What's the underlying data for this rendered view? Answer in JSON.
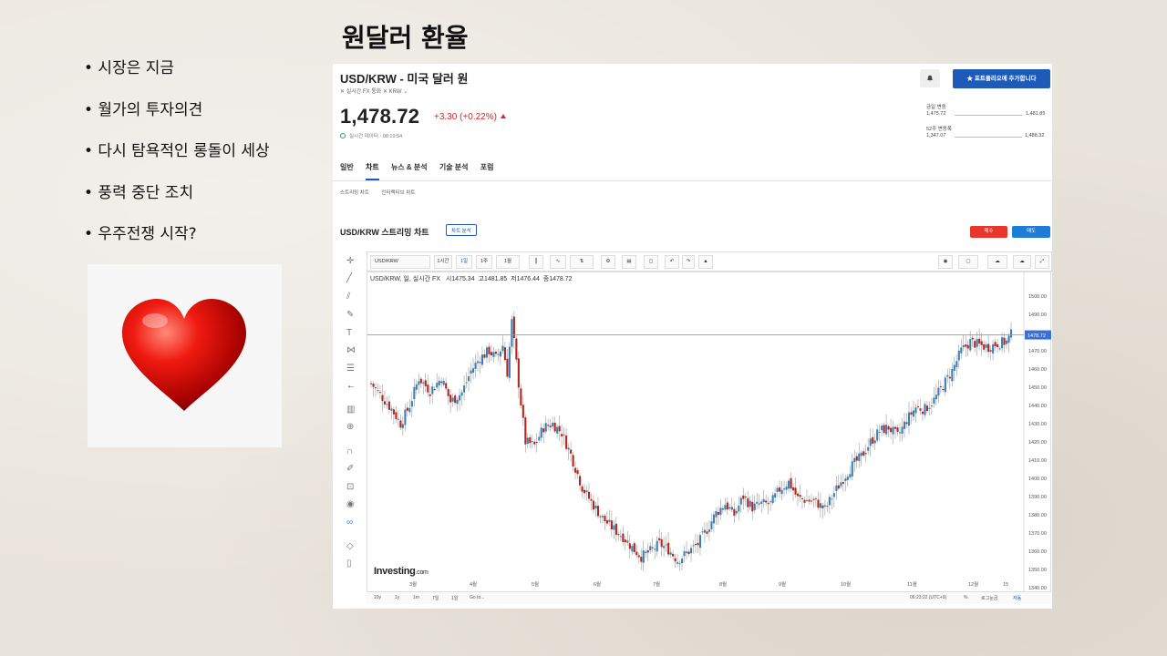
{
  "slide": {
    "title": "원달러 환율",
    "bullets": [
      "• 시장은 지금",
      "• 월가의 투자의견",
      "• 다시 탐욕적인 롱돌이 세상",
      "• 풍력 중단 조치",
      "• 우주전쟁 시작?"
    ]
  },
  "quote": {
    "pair_title": "USD/KRW - 미국 달러 원",
    "meta": "✕  실시간 FX   통화   ✕ KRW  ⌄",
    "price": "1,478.72",
    "change": "+3.30 (+0.22%)",
    "realtime": "실시간 데이터 · 08:19:54",
    "alert_icon": "bell-icon",
    "portfolio_button": "★  포트폴리오에 추가합니다",
    "daily_range_label": "금일 변동",
    "daily_low": "1,475.72",
    "daily_high": "1,481.85",
    "week52_label": "52주 변동폭",
    "week52_low": "1,347.07",
    "week52_high": "1,488.32",
    "tabs": [
      "일반",
      "차트",
      "뉴스 & 분석",
      "기술 분석",
      "포럼"
    ],
    "subtabs": [
      "스트리밍 차트",
      "인터랙티브 차트"
    ],
    "chart_title": "USD/KRW 스트리밍 차트",
    "chart_chip": "차트 분석",
    "sell_label": "매수",
    "buy_label": "매도"
  },
  "toolbar": {
    "symbol": "USD/KRW",
    "intervals": [
      "1시간",
      "1일",
      "1주",
      "1월"
    ],
    "icons": [
      "candles-icon",
      "indicator-icon",
      "compare-icon",
      "settings-icon",
      "save-icon",
      "load-icon",
      "undo-icon",
      "redo-icon",
      "alert-icon",
      "camera-icon",
      "layout-icon",
      "cloud-icon",
      "cloud-upload-icon",
      "fullscreen-icon"
    ]
  },
  "ohlc": {
    "series": "USD/KRW, 일, 실시간 FX",
    "open_label": "시",
    "open": "1475.34",
    "high_label": "고",
    "high": "1481.85",
    "low_label": "저",
    "low": "1476.44",
    "close_label": "종",
    "close": "1478.72"
  },
  "bottombar": {
    "ranges": [
      "10y",
      "1y",
      "1m",
      "7일",
      "1일",
      "Go to..."
    ],
    "time": "06:23:22 (UTC+9)",
    "pct": "%",
    "log": "로그눈금",
    "auto": "자동"
  },
  "logo": {
    "brand": "Investing",
    "suffix": ".com"
  },
  "colors": {
    "up": "#3b7fb8",
    "down": "#b3261e",
    "accent": "#1e5bb8",
    "price_line": "#7b9be0"
  },
  "chart_data": {
    "type": "candlestick",
    "x_ticks": [
      "3월",
      "4월",
      "5월",
      "6월",
      "7월",
      "8월",
      "9월",
      "10월",
      "11월",
      "12월"
    ],
    "y_ticks": [
      1340,
      1350,
      1360,
      1370,
      1380,
      1390,
      1400,
      1410,
      1420,
      1430,
      1440,
      1450,
      1460,
      1470,
      1480,
      1490,
      1500
    ],
    "ylim": [
      1338,
      1502
    ],
    "last_price": "1478.72",
    "y_anchors": [
      [
        0,
        1452
      ],
      [
        4,
        1446
      ],
      [
        9,
        1438
      ],
      [
        13,
        1430
      ],
      [
        17,
        1440
      ],
      [
        21,
        1455
      ],
      [
        26,
        1448
      ],
      [
        31,
        1455
      ],
      [
        35,
        1442
      ],
      [
        40,
        1447
      ],
      [
        44,
        1459
      ],
      [
        48,
        1466
      ],
      [
        52,
        1470
      ],
      [
        55,
        1466
      ],
      [
        58,
        1473
      ],
      [
        60,
        1458
      ],
      [
        62,
        1486
      ],
      [
        65,
        1452
      ],
      [
        68,
        1420
      ],
      [
        72,
        1418
      ],
      [
        76,
        1428
      ],
      [
        80,
        1430
      ],
      [
        84,
        1425
      ],
      [
        88,
        1413
      ],
      [
        93,
        1395
      ],
      [
        97,
        1387
      ],
      [
        102,
        1378
      ],
      [
        107,
        1372
      ],
      [
        111,
        1368
      ],
      [
        115,
        1362
      ],
      [
        119,
        1357
      ],
      [
        123,
        1360
      ],
      [
        127,
        1364
      ],
      [
        131,
        1361
      ],
      [
        135,
        1355
      ],
      [
        139,
        1359
      ],
      [
        144,
        1364
      ],
      [
        148,
        1372
      ],
      [
        152,
        1381
      ],
      [
        156,
        1386
      ],
      [
        160,
        1380
      ],
      [
        164,
        1390
      ],
      [
        168,
        1384
      ],
      [
        172,
        1386
      ],
      [
        176,
        1386
      ],
      [
        180,
        1394
      ],
      [
        184,
        1398
      ],
      [
        188,
        1389
      ],
      [
        192,
        1388
      ],
      [
        196,
        1387
      ],
      [
        200,
        1383
      ],
      [
        204,
        1392
      ],
      [
        208,
        1400
      ],
      [
        212,
        1407
      ],
      [
        216,
        1412
      ],
      [
        220,
        1420
      ],
      [
        224,
        1426
      ],
      [
        228,
        1428
      ],
      [
        232,
        1423
      ],
      [
        236,
        1432
      ],
      [
        240,
        1439
      ],
      [
        244,
        1438
      ],
      [
        248,
        1443
      ],
      [
        252,
        1451
      ],
      [
        256,
        1459
      ],
      [
        260,
        1470
      ],
      [
        264,
        1475
      ],
      [
        268,
        1473
      ],
      [
        272,
        1472
      ],
      [
        276,
        1474
      ],
      [
        280,
        1475
      ],
      [
        282,
        1479
      ]
    ]
  }
}
